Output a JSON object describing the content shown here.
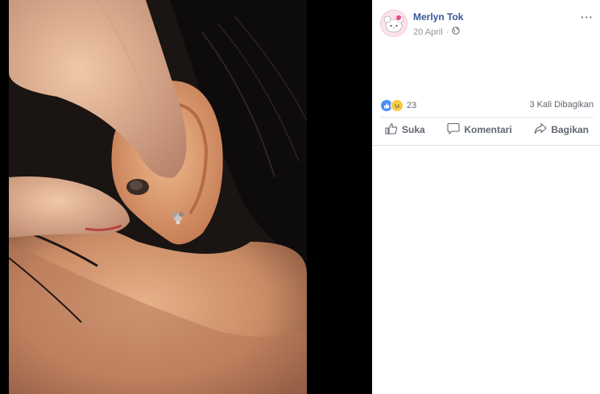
{
  "post": {
    "author": "Merlyn Tok",
    "date": "20 April",
    "separator": "·",
    "more_label": "···"
  },
  "stats": {
    "reaction_count": "23",
    "shares": "3 Kali Dibagikan"
  },
  "actions": {
    "like": "Suka",
    "comment": "Komentari",
    "share": "Bagikan"
  },
  "icons": {
    "privacy": "globe-icon",
    "like": "thumbs-up-icon",
    "comment": "speech-bubble-icon",
    "share": "share-arrow-icon",
    "reaction_like": "like-reaction-icon",
    "reaction_sad": "sad-reaction-icon"
  },
  "colors": {
    "name": "#365899",
    "meta": "#90949c",
    "action": "#606770",
    "like_reaction": "#4f8ef7",
    "sad_reaction": "#f7c944"
  }
}
